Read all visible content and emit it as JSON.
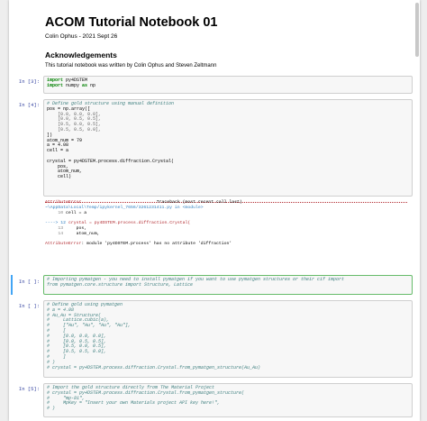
{
  "notebook": {
    "title": "ACOM Tutorial Notebook 01",
    "subtitle": "Colin Ophus - 2021 Sept 26",
    "ack_heading": "Acknowledgements",
    "ack_text": "This tutorial notebook was written by Colin Ophus and Steven Zeltmann"
  },
  "cells": [
    {
      "prompt": "In [3]:"
    },
    {
      "prompt": "In [4]:"
    },
    {
      "prompt": "In [ ]:"
    },
    {
      "prompt": "In [ ]:"
    },
    {
      "prompt": "In [5]:"
    }
  ],
  "code": {
    "c1": [
      {
        "k": "import",
        "t": " py4DSTEM"
      },
      {
        "k": "import",
        "t": " numpy ",
        "k2": "as",
        "t2": " np"
      }
    ],
    "c2_comment": "# Define gold structure using manual definition",
    "c2_lines": [
      "pos = np.array([",
      "    [0.0, 0.0, 0.0],",
      "    [0.0, 0.5, 0.5],",
      "    [0.5, 0.0, 0.5],",
      "    [0.5, 0.5, 0.0],",
      "])",
      "atom_num = 79",
      "a = 4.08",
      "cell = a",
      "",
      "crystal = py4DSTEM.process.diffraction.Crystal(",
      "    pos,",
      "    atom_num,",
      "    cell)"
    ],
    "c3_lines": [
      "# Importing pymatgen - you need to install pymatgen if you want to use pymatgen structures or their cif import",
      "from pymatgen.core.structure import Structure, Lattice"
    ],
    "c4_lines": [
      "# Define gold using pymatgen",
      "# a = 4.08",
      "# Au_Au = Structure(",
      "#     Lattice.cubic(a),",
      "#     [\"Au\", \"Au\", \"Au\", \"Au\"],",
      "#     [",
      "#     [0.0, 0.0, 0.0],",
      "#     [0.0, 0.5, 0.5],",
      "#     [0.5, 0.0, 0.5],",
      "#     [0.5, 0.5, 0.0],",
      "#     ]",
      "# )",
      "# crystal = py4DSTEM.process.diffraction.Crystal.from_pymatgen_structure(Au_Au)"
    ],
    "c5_lines": [
      "# Import the gold structure directly from The Material Project",
      "# crystal = py4DSTEM.process.diffraction.Crystal.from_pymatgen_structure(",
      "#     \"mp-81\",",
      "#     MpKey = \"Insert your own Materials project API key here!\",",
      "# )"
    ]
  },
  "traceback": {
    "error_name": "AttributeError",
    "header_right": "Traceback (most recent call last)",
    "path": "~\\AppData\\Local\\Temp/ipykernel_7656/3261231411.py in <module>",
    "l1_num": "10",
    "l1_code": " cell = a",
    "arrow": "---->",
    "l2_num": "12",
    "l2_code": " crystal = py4DSTEM.process.diffraction.Crystal(",
    "l3_num": "13",
    "l3_code": "     pos,",
    "l4_num": "14",
    "l4_code": "     atom_num,",
    "final_name": "AttributeError",
    "final_msg": ": module 'py4DSTEM.process' has no attribute 'diffraction'"
  }
}
